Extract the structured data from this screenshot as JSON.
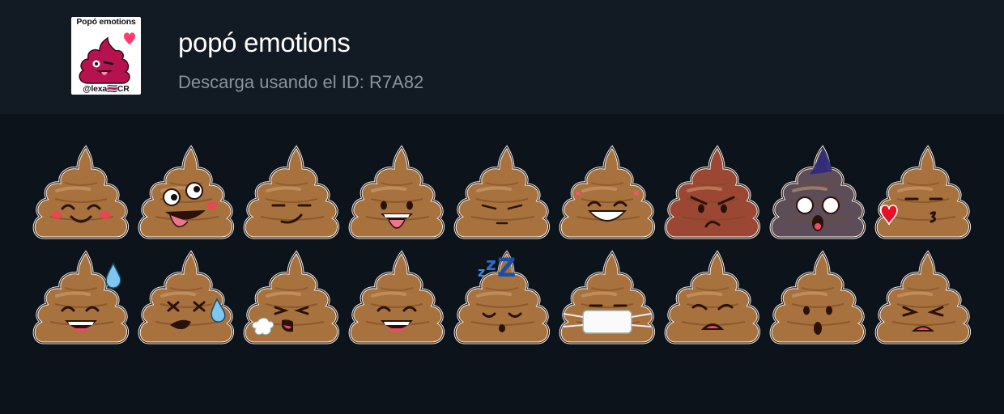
{
  "header": {
    "title": "popó emotions",
    "subtitle": "Descarga usando el ID: R7A82",
    "avatar": {
      "top_label": "Popó emotions",
      "bottom_label": "@lexa🇨🇷CR",
      "icon": "magenta-poop-heart-icon"
    }
  },
  "colors": {
    "background": "#0d131b",
    "header_bg": "#121a23",
    "poop_brown": "#a8723f",
    "poop_light": "#c89562",
    "outline": "#ffffff"
  },
  "stickers": [
    {
      "name": "poop-blush-smile-sticker",
      "emotion": "blush-smile"
    },
    {
      "name": "poop-crazy-tongue-sticker",
      "emotion": "crazy-tongue"
    },
    {
      "name": "poop-smug-sticker",
      "emotion": "smug"
    },
    {
      "name": "poop-tongue-out-sticker",
      "emotion": "tongue-out"
    },
    {
      "name": "poop-sleepy-sticker",
      "emotion": "sleepy"
    },
    {
      "name": "poop-grin-sticker",
      "emotion": "grin"
    },
    {
      "name": "poop-angry-sticker",
      "emotion": "angry"
    },
    {
      "name": "poop-shocked-sticker",
      "emotion": "shocked"
    },
    {
      "name": "poop-kiss-heart-sticker",
      "emotion": "kiss-heart"
    },
    {
      "name": "poop-laugh-sweat-sticker",
      "emotion": "laugh-sweat"
    },
    {
      "name": "poop-dizzy-sticker",
      "emotion": "dizzy"
    },
    {
      "name": "poop-exhale-sticker",
      "emotion": "exhale"
    },
    {
      "name": "poop-laugh-sticker",
      "emotion": "laugh"
    },
    {
      "name": "poop-sleeping-zzz-sticker",
      "emotion": "sleeping"
    },
    {
      "name": "poop-mask-sticker",
      "emotion": "mask"
    },
    {
      "name": "poop-sad-sticker",
      "emotion": "sad"
    },
    {
      "name": "poop-surprised-sticker",
      "emotion": "surprised"
    },
    {
      "name": "poop-upset-sticker",
      "emotion": "upset"
    }
  ]
}
